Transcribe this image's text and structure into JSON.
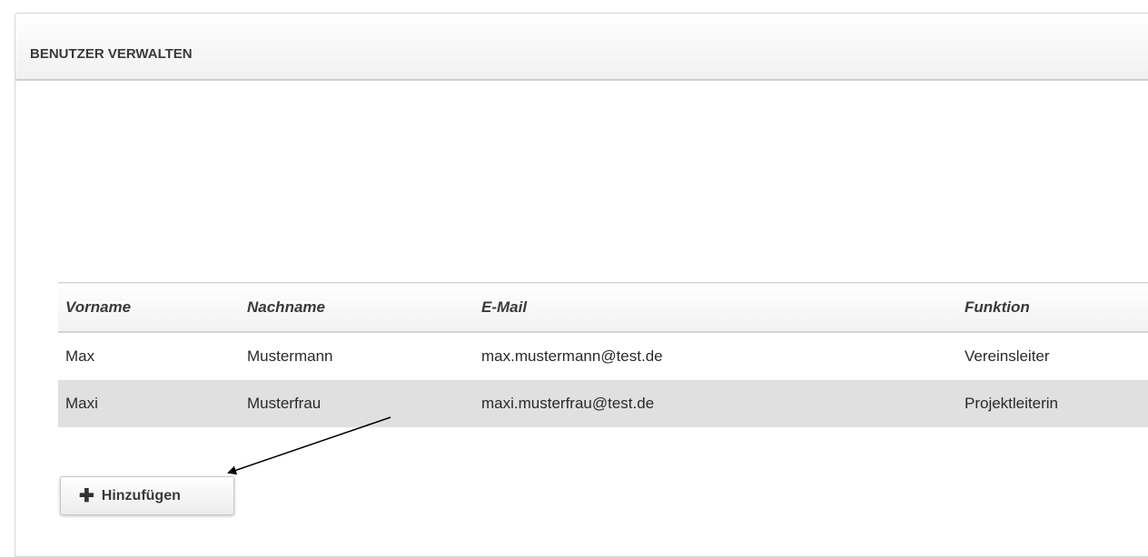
{
  "panel": {
    "title": "BENUTZER VERWALTEN"
  },
  "table": {
    "headers": [
      "Vorname",
      "Nachname",
      "E-Mail",
      "Funktion"
    ],
    "rows": [
      {
        "vorname": "Max",
        "nachname": "Mustermann",
        "email": "max.mustermann@test.de",
        "funktion": "Vereinsleiter"
      },
      {
        "vorname": "Maxi",
        "nachname": "Musterfrau",
        "email": "maxi.musterfrau@test.de",
        "funktion": "Projektleiterin"
      }
    ]
  },
  "add_button": {
    "icon": "plus-icon",
    "label": "Hinzufügen"
  },
  "colors": {
    "alt_row": "#e0e0e0",
    "border": "#d0d0d0",
    "text": "#2a2a2a"
  }
}
